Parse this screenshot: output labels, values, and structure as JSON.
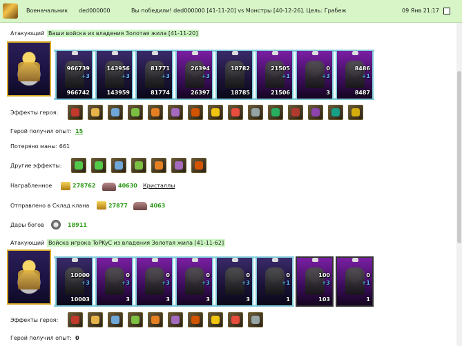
{
  "header": {
    "title": "Военачальник",
    "player": "ded000000",
    "message": "Вы победили! ded000000 [41-11-20] vs Монстры [40-12-26]. Цель: Грабеж",
    "datetime": "09 Янв 21:17"
  },
  "battle1": {
    "attacker_label": "Атакующий",
    "attacker_desc": "Ваши войска из владения Золотая жила [41-11-20]",
    "units": [
      {
        "a": "966739",
        "b": "+3",
        "c": "",
        "d": "966742"
      },
      {
        "a": "143956",
        "b": "+3",
        "c": "",
        "d": "143959"
      },
      {
        "a": "81771",
        "b": "+3",
        "c": "",
        "d": "81774"
      },
      {
        "a": "26394",
        "b": "+3",
        "c": "",
        "d": "26397"
      },
      {
        "a": "18782",
        "b": "",
        "c": "",
        "d": "18785"
      },
      {
        "a": "21505",
        "b": "+1",
        "c": "",
        "d": "21506"
      },
      {
        "a": "0",
        "b": "+3",
        "c": "",
        "d": "3"
      },
      {
        "a": "8486",
        "b": "+1",
        "c": "",
        "d": "8487"
      }
    ],
    "hero_effects_label": "Эффекты героя:",
    "hero_effects": [
      "shield-icon",
      "sword-icon",
      "armor-icon",
      "gem-icon",
      "scroll-icon",
      "axe-icon",
      "helmet-icon",
      "bow-icon",
      "ring-icon",
      "boots-icon",
      "whip-icon",
      "amulet-icon",
      "beast-icon",
      "potion-icon",
      "arrow-icon"
    ],
    "exp_label": "Герой получил опыт:",
    "exp_value": "15",
    "mana_label": "Потеряно маны: 661",
    "other_effects_label": "Другие эффекты:",
    "other_effects": [
      "xp-icon",
      "xp-icon",
      "scroll-icon",
      "sword-icon",
      "sword-icon",
      "sword-icon",
      "sword-icon"
    ],
    "loot_label": "Награбленное",
    "loot_gold": "278762",
    "loot_ore": "40630",
    "loot_crystals": "Кристаллы",
    "clan_label": "Отправлено в Склад клана",
    "clan_gold": "27877",
    "clan_ore": "4063",
    "gifts_label": "Дары богов",
    "gifts_value": "18911"
  },
  "battle2": {
    "attacker_label": "Атакующий",
    "attacker_desc": "Войска игрока ToPKyC из владения Золотая жила [41-11-62]",
    "units": [
      {
        "a": "10000",
        "b": "+3",
        "c": "",
        "d": "10003"
      },
      {
        "a": "0",
        "b": "+3",
        "c": "",
        "d": "3"
      },
      {
        "a": "0",
        "b": "+3",
        "c": "",
        "d": "3"
      },
      {
        "a": "0",
        "b": "+3",
        "c": "",
        "d": "3"
      },
      {
        "a": "0",
        "b": "+3",
        "c": "",
        "d": "3"
      },
      {
        "a": "0",
        "b": "+1",
        "c": "",
        "d": "1"
      },
      {
        "a": "100",
        "b": "+3",
        "c": "",
        "d": "103"
      },
      {
        "a": "0",
        "b": "+1",
        "c": "",
        "d": "1"
      }
    ],
    "hero_effects_label": "Эффекты героя:",
    "hero_effects": [
      "shield-icon",
      "sword-icon",
      "armor-icon",
      "gem-icon",
      "scroll-icon",
      "crystal-icon",
      "bow-icon",
      "heart-icon",
      "beast-icon",
      "potion-icon"
    ],
    "exp_label": "Герой получил опыт:",
    "exp_value": "0"
  }
}
